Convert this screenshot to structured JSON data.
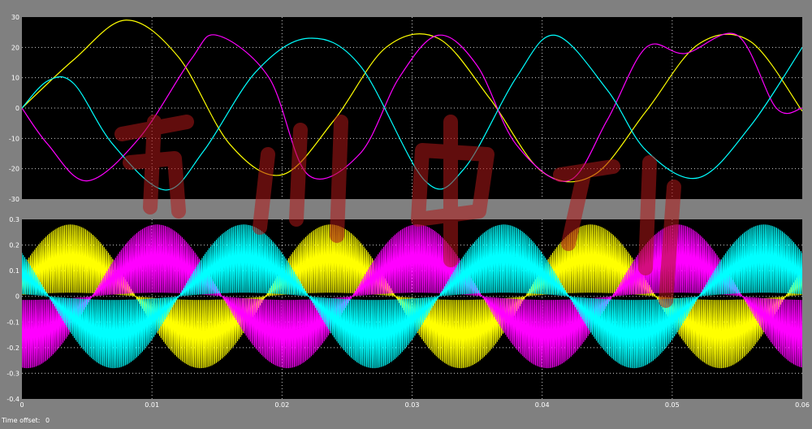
{
  "footer": {
    "time_offset_label": "Time offset:",
    "time_offset_value": "0"
  },
  "colors": {
    "background": "#808080",
    "plot_bg": "#000000",
    "grid": "#ffffff",
    "tick_text": "#ffffff",
    "watermark": "#b01818"
  },
  "chart_data": [
    {
      "type": "line",
      "title": "",
      "xlabel": "",
      "ylabel": "",
      "xlim": [
        0,
        0.06
      ],
      "ylim": [
        -30,
        30
      ],
      "xticks": [],
      "yticks": [
        "-30",
        "-20",
        "-10",
        "0",
        "10",
        "20",
        "30"
      ],
      "grid": true,
      "series": [
        {
          "color": "#ffff00",
          "x": [
            0,
            0.004,
            0.008,
            0.012,
            0.016,
            0.02,
            0.024,
            0.028,
            0.032,
            0.036,
            0.04,
            0.044,
            0.048,
            0.052,
            0.056,
            0.06
          ],
          "y": [
            0,
            16,
            29,
            17,
            -12,
            -22,
            -4,
            20,
            23,
            3,
            -21,
            -22,
            -1,
            21,
            22,
            -1
          ]
        },
        {
          "color": "#ff00ff",
          "x": [
            0,
            0.002,
            0.005,
            0.009,
            0.013,
            0.015,
            0.019,
            0.022,
            0.026,
            0.029,
            0.032,
            0.035,
            0.038,
            0.042,
            0.045,
            0.048,
            0.051,
            0.055,
            0.058,
            0.06
          ],
          "y": [
            0,
            -12,
            -24,
            -10,
            16,
            24,
            10,
            -22,
            -15,
            10,
            24,
            14,
            -12,
            -24,
            -4,
            20,
            18,
            24,
            0,
            0
          ]
        },
        {
          "color": "#00ffff",
          "x": [
            0,
            0.002,
            0.004,
            0.007,
            0.011,
            0.014,
            0.018,
            0.022,
            0.026,
            0.031,
            0.034,
            0.038,
            0.041,
            0.045,
            0.048,
            0.052,
            0.056,
            0.06
          ],
          "y": [
            0,
            9,
            8,
            -12,
            -27,
            -14,
            12,
            23,
            14,
            -24,
            -20,
            10,
            24,
            6,
            -14,
            -23,
            -6,
            20
          ]
        }
      ]
    },
    {
      "type": "line",
      "title": "",
      "xlabel": "",
      "ylabel": "",
      "xlim": [
        0,
        0.06
      ],
      "ylim": [
        -0.4,
        0.3
      ],
      "xticks": [
        "0",
        "0.01",
        "0.02",
        "0.03",
        "0.04",
        "0.05",
        "0.06"
      ],
      "yticks": [
        "-0.4",
        "-0.3",
        "-0.2",
        "-0.1",
        "0",
        "0.1",
        "0.2",
        "0.3"
      ],
      "grid": true,
      "series": [
        {
          "color": "#ffff00",
          "description": "PWM-switched phase current, envelope amplitude ~0.28"
        },
        {
          "color": "#ff00ff",
          "description": "PWM-switched phase current, envelope amplitude ~0.28"
        },
        {
          "color": "#00ffff",
          "description": "PWM-switched phase current, envelope amplitude ~0.28"
        }
      ]
    }
  ]
}
